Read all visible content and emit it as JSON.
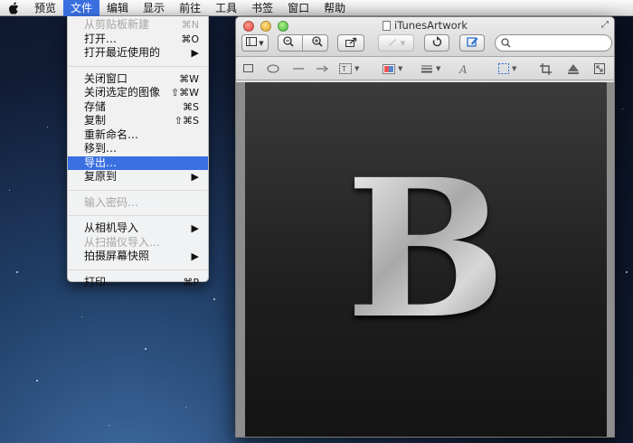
{
  "menubar": {
    "items": [
      {
        "label": "预览"
      },
      {
        "label": "文件"
      },
      {
        "label": "编辑"
      },
      {
        "label": "显示"
      },
      {
        "label": "前往"
      },
      {
        "label": "工具"
      },
      {
        "label": "书签"
      },
      {
        "label": "窗口"
      },
      {
        "label": "帮助"
      }
    ]
  },
  "file_menu": {
    "items": [
      {
        "label": "从剪贴板新建",
        "shortcut": "⌘N"
      },
      {
        "label": "打开…",
        "shortcut": "⌘O"
      },
      {
        "label": "打开最近使用的",
        "shortcut": "▶"
      },
      {
        "label": "关闭窗口",
        "shortcut": "⌘W"
      },
      {
        "label": "关闭选定的图像",
        "shortcut": "⇧⌘W"
      },
      {
        "label": "存储",
        "shortcut": "⌘S"
      },
      {
        "label": "复制",
        "shortcut": "⇧⌘S"
      },
      {
        "label": "重新命名…",
        "shortcut": ""
      },
      {
        "label": "移到…",
        "shortcut": ""
      },
      {
        "label": "导出…",
        "shortcut": ""
      },
      {
        "label": "复原到",
        "shortcut": "▶"
      },
      {
        "label": "输入密码…",
        "shortcut": ""
      },
      {
        "label": "从相机导入",
        "shortcut": "▶"
      },
      {
        "label": "从扫描仪导入…",
        "shortcut": ""
      },
      {
        "label": "拍摄屏幕快照",
        "shortcut": "▶"
      },
      {
        "label": "打印…",
        "shortcut": "⌘P"
      }
    ]
  },
  "window": {
    "title": "iTunesArtwork",
    "image_letter": "B"
  },
  "icons": {
    "apple": "apple-logo-icon",
    "sidebar": "sidebar-toggle-icon",
    "zoom_out": "zoom-out-icon",
    "zoom_in": "zoom-in-icon",
    "share": "share-icon",
    "pen": "pen-icon",
    "rotate": "rotate-icon",
    "annotate": "annotate-icon",
    "search": "search-icon",
    "rectangle": "rectangle-icon",
    "oval": "oval-icon",
    "line": "line-icon",
    "arrow": "arrow-icon",
    "text_box": "text-box-icon",
    "color": "color-swatch-icon",
    "line_weight": "line-weight-icon",
    "font": "font-icon",
    "select": "selection-icon",
    "crop": "crop-icon",
    "adjust": "adjust-color-icon",
    "resize": "resize-icon",
    "fullscreen": "fullscreen-icon",
    "document": "document-icon"
  },
  "colors": {
    "menu_highlight": "#3a6fe0"
  }
}
